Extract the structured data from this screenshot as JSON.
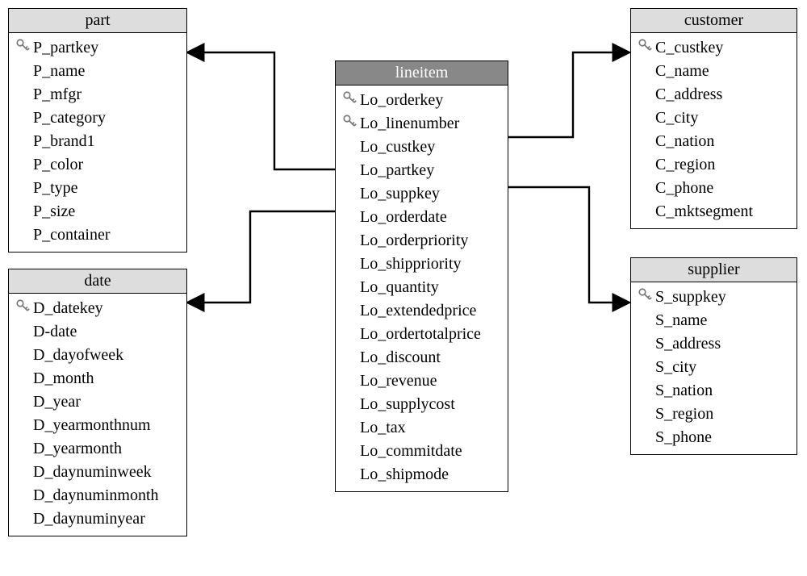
{
  "entities": {
    "part": {
      "title": "part",
      "fields": [
        {
          "name": "P_partkey",
          "key": true
        },
        {
          "name": "P_name",
          "key": false
        },
        {
          "name": "P_mfgr",
          "key": false
        },
        {
          "name": "P_category",
          "key": false
        },
        {
          "name": "P_brand1",
          "key": false
        },
        {
          "name": "P_color",
          "key": false
        },
        {
          "name": "P_type",
          "key": false
        },
        {
          "name": "P_size",
          "key": false
        },
        {
          "name": "P_container",
          "key": false
        }
      ]
    },
    "date": {
      "title": "date",
      "fields": [
        {
          "name": "D_datekey",
          "key": true
        },
        {
          "name": "D-date",
          "key": false
        },
        {
          "name": "D_dayofweek",
          "key": false
        },
        {
          "name": "D_month",
          "key": false
        },
        {
          "name": "D_year",
          "key": false
        },
        {
          "name": "D_yearmonthnum",
          "key": false
        },
        {
          "name": "D_yearmonth",
          "key": false
        },
        {
          "name": "D_daynuminweek",
          "key": false
        },
        {
          "name": "D_daynuminmonth",
          "key": false
        },
        {
          "name": "D_daynuminyear",
          "key": false
        }
      ]
    },
    "lineitem": {
      "title": "lineitem",
      "fields": [
        {
          "name": "Lo_orderkey",
          "key": true
        },
        {
          "name": "Lo_linenumber",
          "key": true
        },
        {
          "name": "Lo_custkey",
          "key": false
        },
        {
          "name": "Lo_partkey",
          "key": false
        },
        {
          "name": "Lo_suppkey",
          "key": false
        },
        {
          "name": "Lo_orderdate",
          "key": false
        },
        {
          "name": "Lo_orderpriority",
          "key": false
        },
        {
          "name": "Lo_shippriority",
          "key": false
        },
        {
          "name": "Lo_quantity",
          "key": false
        },
        {
          "name": "Lo_extendedprice",
          "key": false
        },
        {
          "name": "Lo_ordertotalprice",
          "key": false
        },
        {
          "name": "Lo_discount",
          "key": false
        },
        {
          "name": "Lo_revenue",
          "key": false
        },
        {
          "name": "Lo_supplycost",
          "key": false
        },
        {
          "name": "Lo_tax",
          "key": false
        },
        {
          "name": "Lo_commitdate",
          "key": false
        },
        {
          "name": "Lo_shipmode",
          "key": false
        }
      ]
    },
    "customer": {
      "title": "customer",
      "fields": [
        {
          "name": "C_custkey",
          "key": true
        },
        {
          "name": "C_name",
          "key": false
        },
        {
          "name": "C_address",
          "key": false
        },
        {
          "name": "C_city",
          "key": false
        },
        {
          "name": "C_nation",
          "key": false
        },
        {
          "name": "C_region",
          "key": false
        },
        {
          "name": "C_phone",
          "key": false
        },
        {
          "name": "C_mktsegment",
          "key": false
        }
      ]
    },
    "supplier": {
      "title": "supplier",
      "fields": [
        {
          "name": "S_suppkey",
          "key": true
        },
        {
          "name": "S_name",
          "key": false
        },
        {
          "name": "S_address",
          "key": false
        },
        {
          "name": "S_city",
          "key": false
        },
        {
          "name": "S_nation",
          "key": false
        },
        {
          "name": "S_region",
          "key": false
        },
        {
          "name": "S_phone",
          "key": false
        }
      ]
    }
  }
}
